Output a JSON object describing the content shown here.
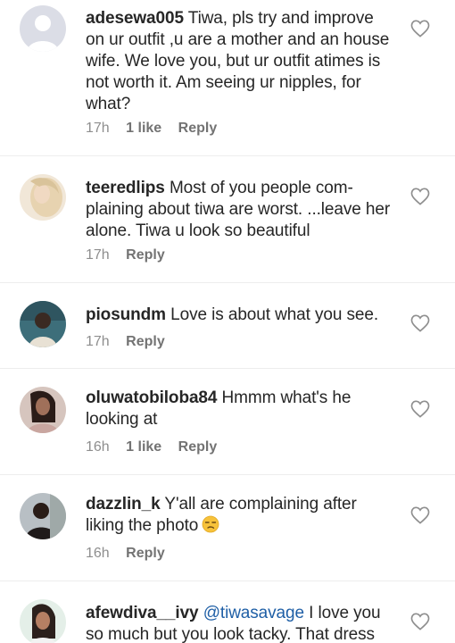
{
  "colors": {
    "text": "#262626",
    "meta": "#8e8e8e",
    "mention": "#1f5fa6",
    "divider": "#ededed"
  },
  "comments": [
    {
      "username": "adesewa005",
      "text": "Tiwa, pls try and improve on ur outfit ,u are a mother and an house wife.  We love you, but ur outfit atimes is not worth it. Am seeing ur nipples, for what?",
      "time": "17h",
      "likes": "1 like",
      "reply": "Reply",
      "avatar": "default-avatar",
      "icon": "heart-outline-icon"
    },
    {
      "username": "teeredlips",
      "text": "Most of you people com-plaining about tiwa are worst. ...leave her alone. Tiwa u look so beautiful",
      "time": "17h",
      "reply": "Reply",
      "avatar": "photo-avatar",
      "icon": "heart-outline-icon"
    },
    {
      "username": "piosundm",
      "text": "Love is about what you see.",
      "time": "17h",
      "reply": "Reply",
      "avatar": "photo-avatar",
      "icon": "heart-outline-icon"
    },
    {
      "username": "oluwatobiloba84",
      "text": "Hmmm what's he looking at",
      "time": "16h",
      "likes": "1 like",
      "reply": "Reply",
      "avatar": "photo-avatar",
      "icon": "heart-outline-icon"
    },
    {
      "username": "dazzlin_k",
      "text": "Y'all are complaining after liking the photo",
      "emoji": "unamused-face-emoji",
      "time": "16h",
      "reply": "Reply",
      "avatar": "photo-avatar",
      "icon": "heart-outline-icon"
    },
    {
      "username": "afewdiva__ivy",
      "mention": "@tiwasavage",
      "text": "I love you so much but you look tacky. That dress",
      "avatar": "photo-avatar",
      "icon": "heart-outline-icon"
    }
  ]
}
